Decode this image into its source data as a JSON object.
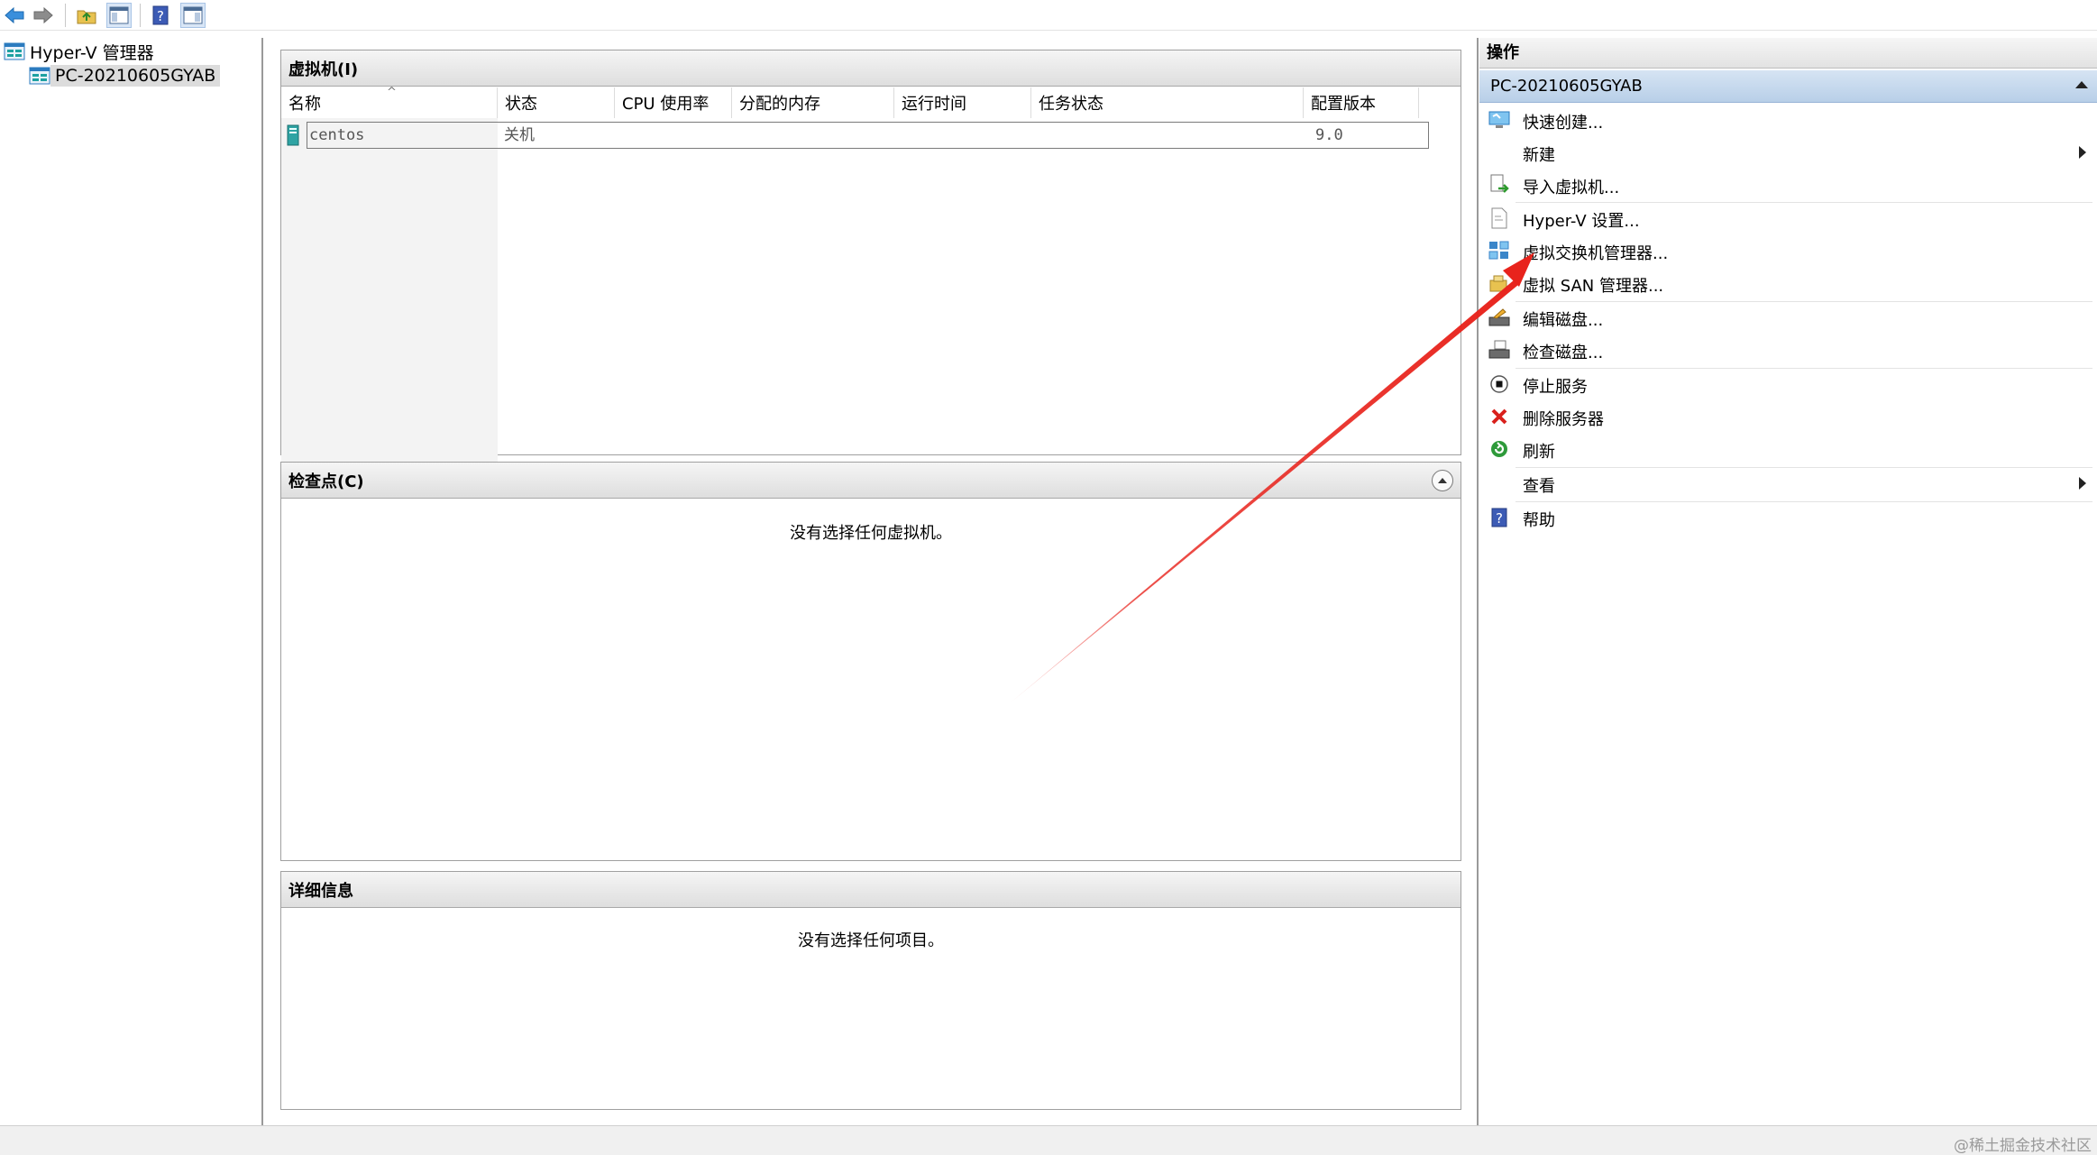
{
  "toolbar": {
    "buttons": [
      "back-icon",
      "forward-icon",
      "up-folder-icon",
      "show-hide-console-tree-icon",
      "help-icon",
      "show-hide-action-pane-icon"
    ]
  },
  "tree": {
    "root_label": "Hyper-V 管理器",
    "server_label": "PC-20210605GYAB"
  },
  "vm_panel": {
    "title": "虚拟机(I)",
    "columns": [
      "名称",
      "状态",
      "CPU 使用率",
      "分配的内存",
      "运行时间",
      "任务状态",
      "配置版本"
    ],
    "rows": [
      {
        "name": "centos",
        "state": "关机",
        "cpu": "",
        "memory": "",
        "uptime": "",
        "task": "",
        "version": "9.0"
      }
    ]
  },
  "checkpoint_panel": {
    "title": "检查点(C)",
    "empty_message": "没有选择任何虚拟机。"
  },
  "details_panel": {
    "title": "详细信息",
    "empty_message": "没有选择任何项目。"
  },
  "actions": {
    "title": "操作",
    "group_label": "PC-20210605GYAB",
    "items": [
      {
        "label": "快速创建...",
        "icon": "quick-create-icon"
      },
      {
        "label": "新建",
        "icon": "",
        "submenu": true
      },
      {
        "label": "导入虚拟机...",
        "icon": "import-vm-icon"
      },
      {
        "label": "Hyper-V 设置...",
        "icon": "settings-page-icon"
      },
      {
        "label": "虚拟交换机管理器...",
        "icon": "virtual-switch-icon"
      },
      {
        "label": "虚拟 SAN 管理器...",
        "icon": "san-manager-icon"
      },
      {
        "label": "编辑磁盘...",
        "icon": "edit-disk-icon"
      },
      {
        "label": "检查磁盘...",
        "icon": "inspect-disk-icon"
      },
      {
        "label": "停止服务",
        "icon": "stop-service-icon"
      },
      {
        "label": "删除服务器",
        "icon": "remove-server-icon"
      },
      {
        "label": "刷新",
        "icon": "refresh-icon"
      },
      {
        "label": "查看",
        "icon": "",
        "submenu": true
      },
      {
        "label": "帮助",
        "icon": "help-icon"
      }
    ]
  },
  "statusbar": {
    "watermark": "@稀土掘金技术社区"
  },
  "colors": {
    "selection_blue": "#b8cfe8",
    "annotation_arrow": "#e8231c"
  }
}
